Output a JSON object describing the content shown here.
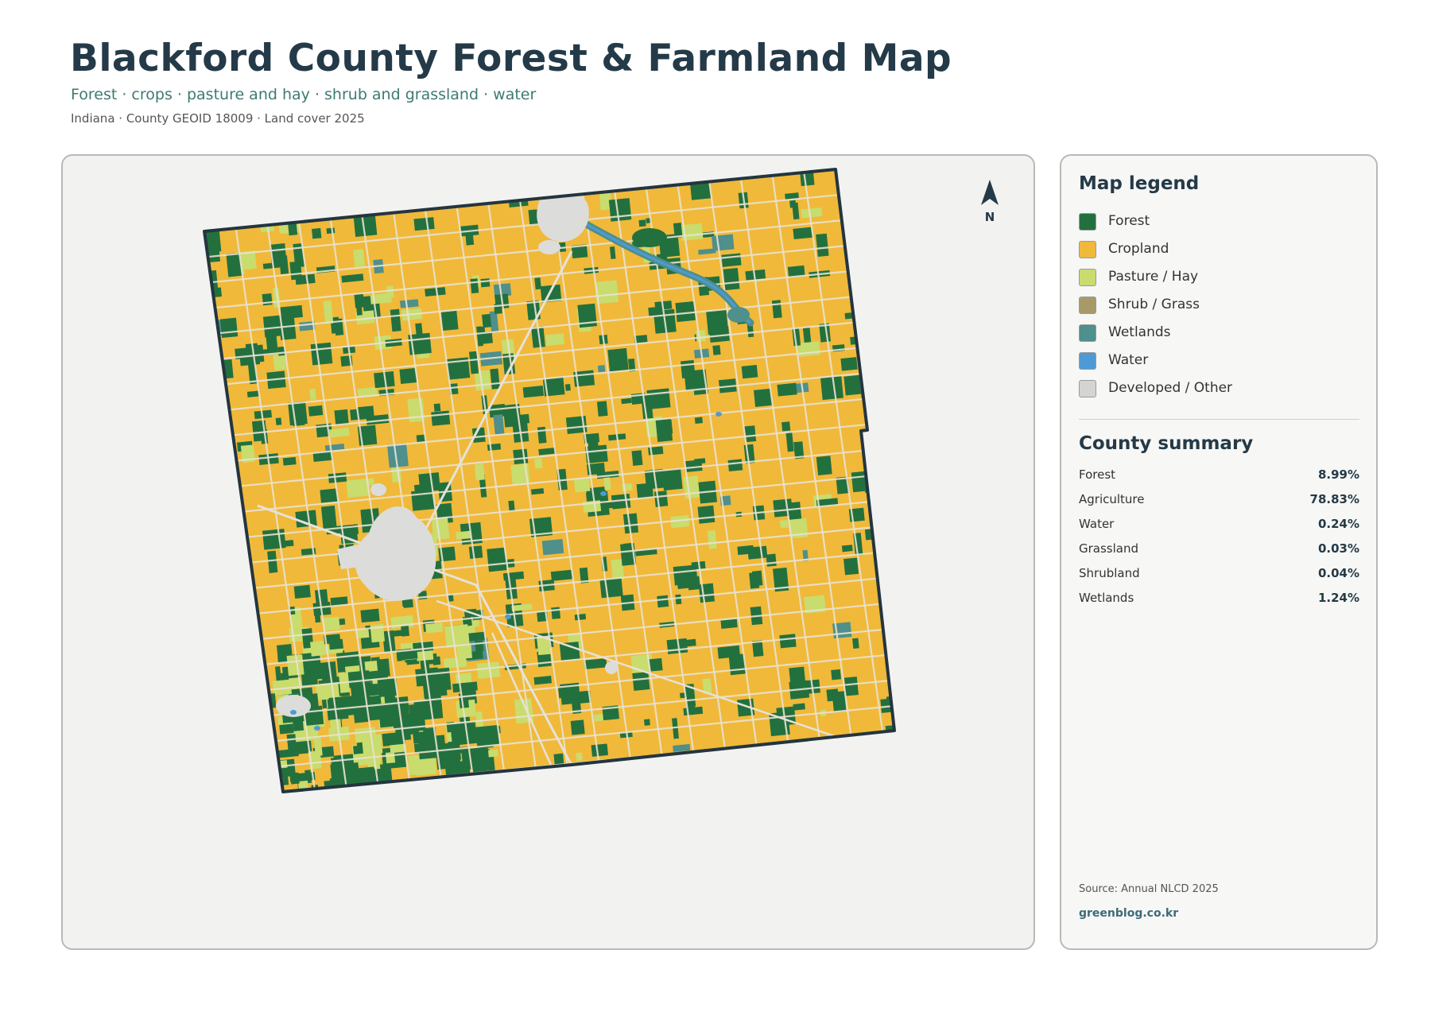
{
  "header": {
    "title": "Blackford County Forest & Farmland Map",
    "subtitle": "Forest · crops · pasture and hay · shrub and grassland · water",
    "meta": "Indiana · County GEOID 18009 · Land cover 2025"
  },
  "map": {
    "north_label": "N",
    "colors": {
      "forest": "#23703f",
      "cropland": "#f0b93a",
      "pasture": "#c9dc6e",
      "shrub": "#a89a68",
      "wetlands": "#4f8f8c",
      "water": "#4d9ad6",
      "developed": "#dcdcda",
      "boundary": "#23353f"
    }
  },
  "legend": {
    "title": "Map legend",
    "items": [
      {
        "label": "Forest",
        "color": "#23703f"
      },
      {
        "label": "Cropland",
        "color": "#f0b93a"
      },
      {
        "label": "Pasture / Hay",
        "color": "#c9dc6e"
      },
      {
        "label": "Shrub / Grass",
        "color": "#a89a68"
      },
      {
        "label": "Wetlands",
        "color": "#4f8f8c"
      },
      {
        "label": "Water",
        "color": "#4d9ad6"
      },
      {
        "label": "Developed / Other",
        "color": "#d4d4d2"
      }
    ]
  },
  "summary": {
    "title": "County summary",
    "rows": [
      {
        "label": "Forest",
        "value": "8.99%"
      },
      {
        "label": "Agriculture",
        "value": "78.83%"
      },
      {
        "label": "Water",
        "value": "0.24%"
      },
      {
        "label": "Grassland",
        "value": "0.03%"
      },
      {
        "label": "Shrubland",
        "value": "0.04%"
      },
      {
        "label": "Wetlands",
        "value": "1.24%"
      }
    ]
  },
  "footer": {
    "source": "Source: Annual NLCD 2025",
    "brand": "greenblog.co.kr"
  }
}
